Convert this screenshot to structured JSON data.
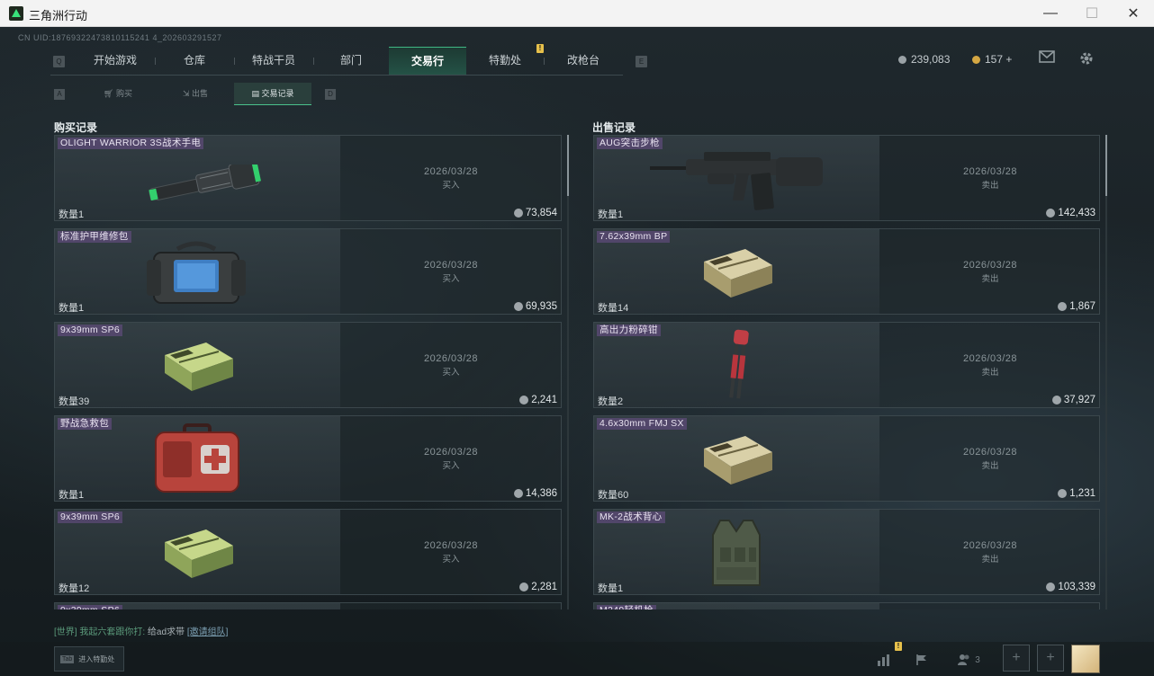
{
  "window": {
    "title": "三角洲行动",
    "minimize": "—",
    "maximize": "☐",
    "close": "✕"
  },
  "uid_text": "CN UID:18769322473810115241 4_202603291527",
  "nav": {
    "left_key": "Q",
    "right_key": "E",
    "items": [
      {
        "label": "开始游戏"
      },
      {
        "label": "仓库"
      },
      {
        "label": "特战干员"
      },
      {
        "label": "部门"
      },
      {
        "label": "交易行",
        "active": true
      },
      {
        "label": "特勤处"
      },
      {
        "label": "改枪台"
      }
    ],
    "badge": "!"
  },
  "currency": {
    "silver": "239,083",
    "gold": "157 +"
  },
  "top_icons": [
    "mail-icon",
    "gear-icon"
  ],
  "subnav": {
    "left_key": "A",
    "right_key": "D",
    "items": [
      {
        "label": "购买",
        "icon": "cart-icon"
      },
      {
        "label": "出售",
        "icon": "sell-icon"
      },
      {
        "label": "交易记录",
        "icon": "record-icon",
        "active": true
      }
    ]
  },
  "buy_section": {
    "title": "购买记录",
    "records": [
      {
        "name": "OLIGHT WARRIOR 3S战术手电",
        "qty": "数量1",
        "price": "73,854",
        "date": "2026/03/28",
        "kind": "买入",
        "art": "flashlight"
      },
      {
        "name": "标准护甲维修包",
        "qty": "数量1",
        "price": "69,935",
        "date": "2026/03/28",
        "kind": "买入",
        "art": "bag"
      },
      {
        "name": "9x39mm SP6",
        "qty": "数量39",
        "price": "2,241",
        "date": "2026/03/28",
        "kind": "买入",
        "art": "ammo-green"
      },
      {
        "name": "野战急救包",
        "qty": "数量1",
        "price": "14,386",
        "date": "2026/03/28",
        "kind": "买入",
        "art": "medkit"
      },
      {
        "name": "9x39mm SP6",
        "qty": "数量12",
        "price": "2,281",
        "date": "2026/03/28",
        "kind": "买入",
        "art": "ammo-green"
      },
      {
        "name": "9x39mm SP6",
        "qty": "",
        "price": "",
        "date": "",
        "kind": "",
        "art": "ammo-green"
      }
    ]
  },
  "sell_section": {
    "title": "出售记录",
    "records": [
      {
        "name": "AUG突击步枪",
        "qty": "数量1",
        "price": "142,433",
        "date": "2026/03/28",
        "kind": "卖出",
        "art": "rifle"
      },
      {
        "name": "7.62x39mm BP",
        "qty": "数量14",
        "price": "1,867",
        "date": "2026/03/28",
        "kind": "卖出",
        "art": "ammo-tan"
      },
      {
        "name": "高出力粉碎钳",
        "qty": "数量2",
        "price": "37,927",
        "date": "2026/03/28",
        "kind": "卖出",
        "art": "cutter"
      },
      {
        "name": "4.6x30mm FMJ SX",
        "qty": "数量60",
        "price": "1,231",
        "date": "2026/03/28",
        "kind": "卖出",
        "art": "ammo-tan"
      },
      {
        "name": "MK-2战术背心",
        "qty": "数量1",
        "price": "103,339",
        "date": "2026/03/28",
        "kind": "卖出",
        "art": "vest"
      },
      {
        "name": "M249轻机枪",
        "qty": "",
        "price": "",
        "date": "",
        "kind": "",
        "art": "rifle"
      }
    ]
  },
  "chat": {
    "channel": "[世界]",
    "speaker": "我起六套跟你打:",
    "message": "给ad求带",
    "link": "[邀请组队]"
  },
  "bottom": {
    "tab_key": "Tab",
    "tab_label": "进入特勤处",
    "friends_count": "3",
    "badge": "!"
  }
}
